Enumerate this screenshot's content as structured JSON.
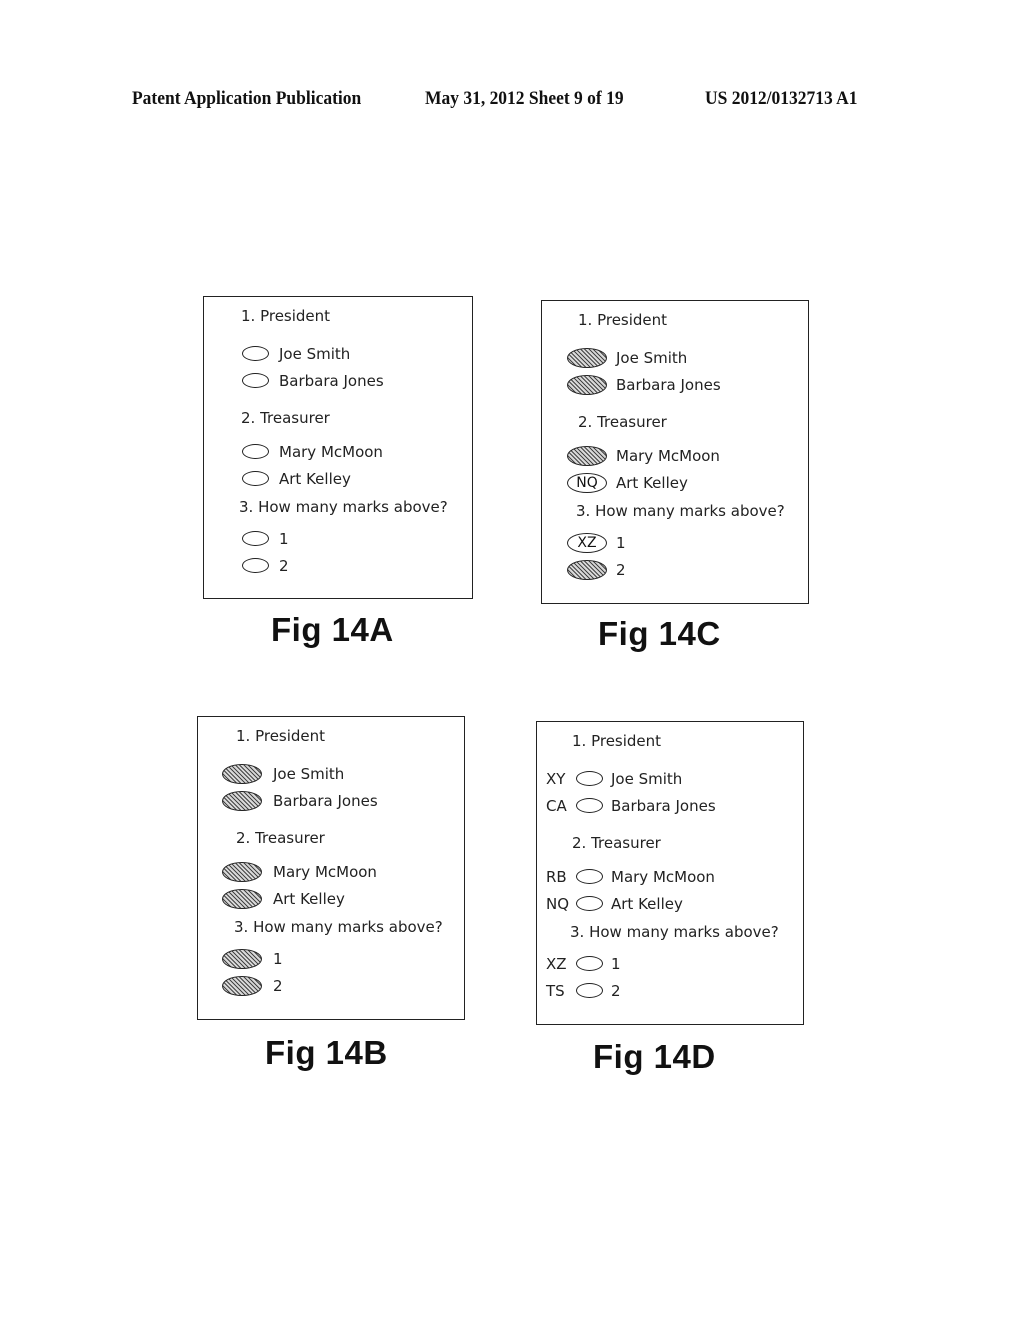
{
  "header": {
    "left": "Patent Application Publication",
    "middle": "May 31, 2012  Sheet 9 of 19",
    "right": "US 2012/0132713 A1"
  },
  "figures": [
    {
      "caption": "Fig 14A",
      "questions": [
        {
          "title": "1. President",
          "options": [
            {
              "label": "Joe Smith",
              "state": "empty"
            },
            {
              "label": "Barbara Jones",
              "state": "empty"
            }
          ]
        },
        {
          "title": "2. Treasurer",
          "options": [
            {
              "label": "Mary McMoon",
              "state": "empty"
            },
            {
              "label": "Art Kelley",
              "state": "empty"
            }
          ]
        },
        {
          "title": "3. How many marks above?",
          "options": [
            {
              "label": "1",
              "state": "empty"
            },
            {
              "label": "2",
              "state": "empty"
            }
          ]
        }
      ]
    },
    {
      "caption": "Fig 14C",
      "questions": [
        {
          "title": "1. President",
          "options": [
            {
              "label": "Joe Smith",
              "state": "filled"
            },
            {
              "label": "Barbara Jones",
              "state": "filled"
            }
          ]
        },
        {
          "title": "2. Treasurer",
          "options": [
            {
              "label": "Mary McMoon",
              "state": "filled"
            },
            {
              "label": "Art Kelley",
              "state": "code",
              "code": "NQ"
            }
          ]
        },
        {
          "title": "3. How many marks above?",
          "options": [
            {
              "label": "1",
              "state": "code",
              "code": "XZ"
            },
            {
              "label": "2",
              "state": "filled"
            }
          ]
        }
      ]
    },
    {
      "caption": "Fig 14B",
      "questions": [
        {
          "title": "1. President",
          "options": [
            {
              "label": "Joe Smith",
              "state": "filled"
            },
            {
              "label": "Barbara Jones",
              "state": "filled"
            }
          ]
        },
        {
          "title": "2. Treasurer",
          "options": [
            {
              "label": "Mary McMoon",
              "state": "filled"
            },
            {
              "label": "Art Kelley",
              "state": "filled"
            }
          ]
        },
        {
          "title": "3. How many marks above?",
          "options": [
            {
              "label": "1",
              "state": "filled"
            },
            {
              "label": "2",
              "state": "filled"
            }
          ]
        }
      ]
    },
    {
      "caption": "Fig 14D",
      "questions": [
        {
          "title": "1. President",
          "options": [
            {
              "label": "Joe Smith",
              "state": "empty",
              "prefix": "XY"
            },
            {
              "label": "Barbara Jones",
              "state": "empty",
              "prefix": "CA"
            }
          ]
        },
        {
          "title": "2. Treasurer",
          "options": [
            {
              "label": "Mary McMoon",
              "state": "empty",
              "prefix": "RB"
            },
            {
              "label": "Art Kelley",
              "state": "empty",
              "prefix": "NQ"
            }
          ]
        },
        {
          "title": "3. How many marks above?",
          "options": [
            {
              "label": "1",
              "state": "empty",
              "prefix": "XZ"
            },
            {
              "label": "2",
              "state": "empty",
              "prefix": "TS"
            }
          ]
        }
      ]
    }
  ]
}
